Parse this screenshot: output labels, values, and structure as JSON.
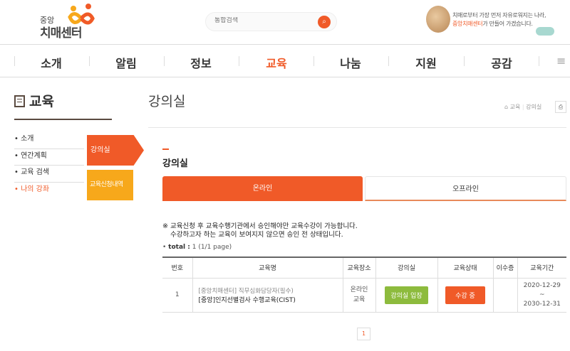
{
  "header": {
    "logo_small": "중앙",
    "logo_big": "치매센터",
    "search_placeholder": "통합검색",
    "promo_line1": "치매로부터 가장 먼저 자유로워지는 나라,",
    "promo_highlight": "중앙치매센터",
    "promo_line2_rest": "가 만들어 가겠습니다."
  },
  "nav": {
    "items": [
      "소개",
      "알림",
      "정보",
      "교육",
      "나눔",
      "지원",
      "공감"
    ],
    "active": "교육"
  },
  "sidebar": {
    "title": "교육",
    "items": [
      "소개",
      "연간계획",
      "교육 검색",
      "나의 강좌"
    ],
    "sub_items": [
      "강의실",
      "교육신청내역"
    ]
  },
  "main": {
    "title": "강의실",
    "breadcrumb": [
      "교육",
      "강의실"
    ],
    "section_title": "강의실",
    "tabs": [
      "온라인",
      "오프라인"
    ],
    "notice_line1": "※ 교육신청 후 교육수행기관에서 승인해야만 교육수강이 가능합니다.",
    "notice_line2": "수강하고자 하는 교육이 보여지지 않으면 승인 전 상태입니다.",
    "total_label": "total :",
    "total_value": "1 (1/1 page)"
  },
  "table": {
    "headers": [
      "번호",
      "교육명",
      "교육장소",
      "강의실",
      "교육상태",
      "이수증",
      "교육기간"
    ],
    "rows": [
      {
        "no": "1",
        "category": "[중앙치매센터] 직무심화담당자(필수)",
        "name": "[중앙]인지선별검사 수행교육(CIST)",
        "place_1": "온라인",
        "place_2": "교육",
        "room_btn": "강의실 입장",
        "status_btn": "수강 중",
        "cert": "",
        "start": "2020-12-29",
        "sep": "~",
        "end": "2030-12-31"
      }
    ]
  },
  "pagination": {
    "current": "1"
  },
  "colors": {
    "accent": "#f05a28",
    "yellow": "#f7a81b",
    "green": "#8dbb3d"
  }
}
